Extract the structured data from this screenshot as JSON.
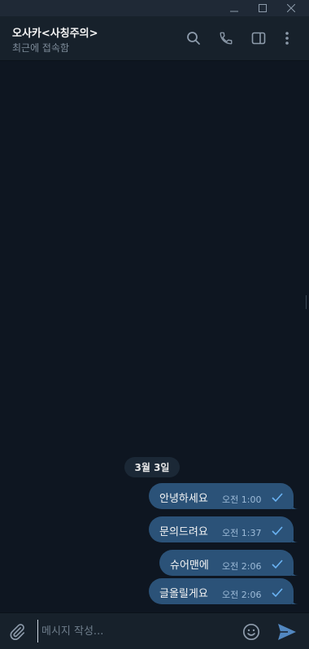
{
  "window": {
    "controls": {
      "minimize_icon": "minimize-icon",
      "maximize_icon": "maximize-icon",
      "close_icon": "close-icon"
    }
  },
  "header": {
    "title": "오사카<사칭주의>",
    "status": "최근에 접속함",
    "icons": [
      "search-icon",
      "phone-icon",
      "sidebar-toggle-icon",
      "more-vertical-icon"
    ]
  },
  "chat": {
    "date_divider": "3월 3일",
    "messages": [
      {
        "text": "안녕하세요",
        "time": "오전 1:00",
        "status": "sent"
      },
      {
        "text": "문의드려요",
        "time": "오전 1:37",
        "status": "sent"
      },
      {
        "text": "슈어맨에",
        "time": "오전 2:06",
        "status": "sent"
      },
      {
        "text": "글올릴게요",
        "time": "오전 2:06",
        "status": "sent"
      }
    ]
  },
  "composer": {
    "placeholder": "메시지 작성...",
    "value": ""
  },
  "colors": {
    "background": "#0e1621",
    "header": "#17212b",
    "outgoing_bubble": "#2b5278",
    "accent": "#5288c1"
  }
}
